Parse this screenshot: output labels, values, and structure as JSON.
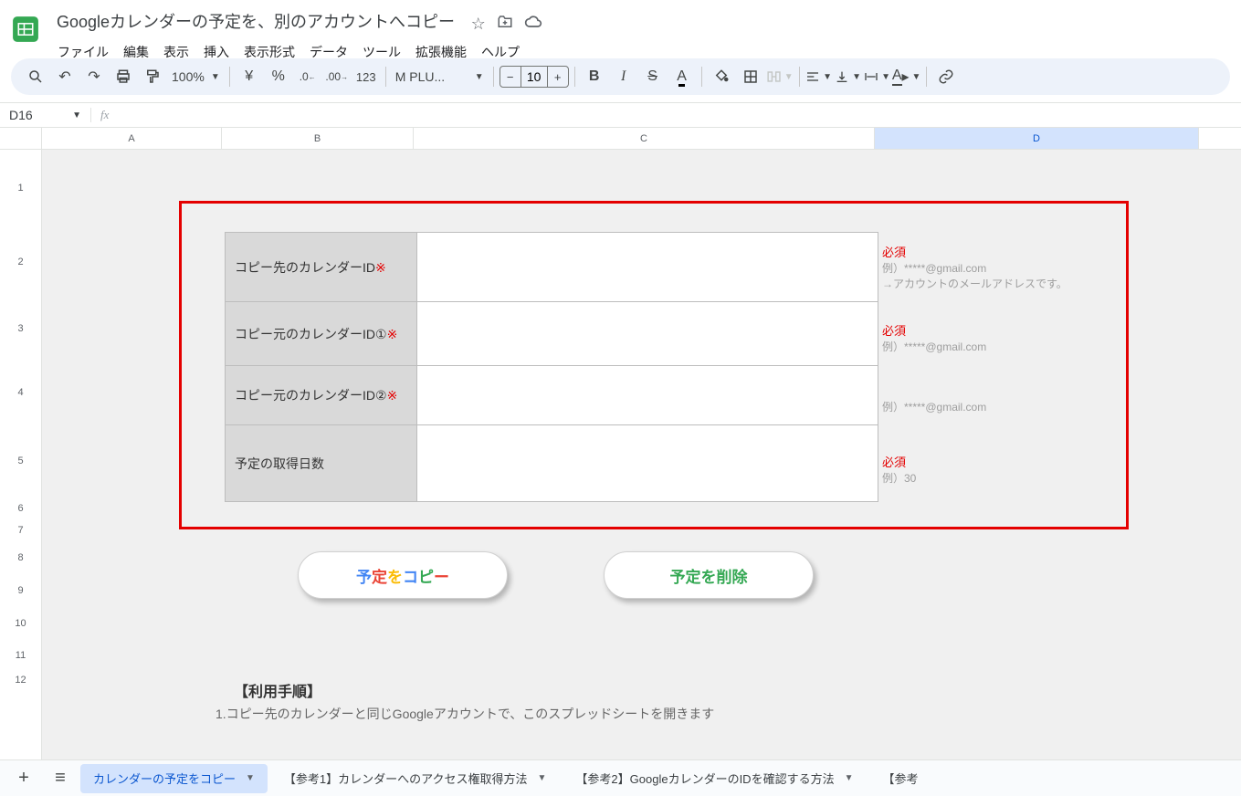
{
  "doc": {
    "title": "Googleカレンダーの予定を、別のアカウントへコピー"
  },
  "menu": {
    "file": "ファイル",
    "edit": "編集",
    "view": "表示",
    "insert": "挿入",
    "format": "表示形式",
    "data": "データ",
    "tools": "ツール",
    "extensions": "拡張機能",
    "help": "ヘルプ"
  },
  "toolbar": {
    "zoom": "100%",
    "currency": "¥",
    "percent": "%",
    "font": "M PLU...",
    "fontsize": "10",
    "decdec": ".0",
    "incdec": ".00",
    "numfmt": "123"
  },
  "namebox": {
    "value": "D16"
  },
  "columns": {
    "A": "A",
    "B": "B",
    "C": "C",
    "D": "D"
  },
  "rows": [
    "1",
    "2",
    "3",
    "4",
    "5",
    "6",
    "7",
    "8",
    "9",
    "10",
    "11",
    "12"
  ],
  "form": {
    "row1_label": "コピー先のカレンダーID",
    "required_mark": "※",
    "row2_label": "コピー元のカレンダーID①",
    "row3_label": "コピー元のカレンダーID②",
    "row4_label": "予定の取得日数"
  },
  "notes": {
    "required": "必須",
    "ex_gmail": "例）*****@gmail.com",
    "account_hint": "→アカウントのメールアドレスです。",
    "ex_30": "例）30"
  },
  "buttons": {
    "copy_p1": "予",
    "copy_p2": "定",
    "copy_p3": "を",
    "copy_p4": "コ",
    "copy_p5": "ピ",
    "copy_p6": "ー",
    "delete": "予定を削除"
  },
  "usage": {
    "heading": "【利用手順】",
    "line1": "1.コピー先のカレンダーと同じGoogleアカウントで、このスプレッドシートを開きます"
  },
  "tabs": {
    "active": "カレンダーの予定をコピー",
    "ref1": "【参考1】カレンダーへのアクセス権取得方法",
    "ref2": "【参考2】GoogleカレンダーのIDを確認する方法",
    "ref3": "【参考"
  }
}
